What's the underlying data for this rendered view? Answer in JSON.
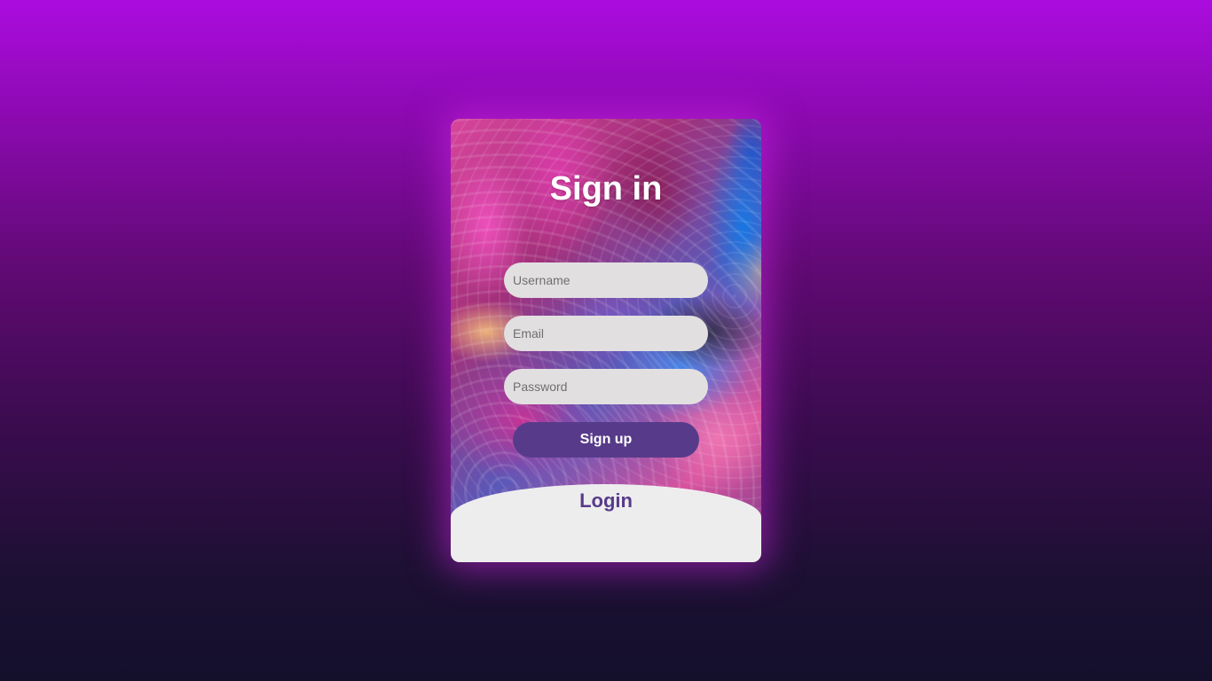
{
  "form": {
    "title": "Sign in",
    "username": {
      "placeholder": "Username",
      "value": ""
    },
    "email": {
      "placeholder": "Email",
      "value": ""
    },
    "password": {
      "placeholder": "Password",
      "value": ""
    },
    "submit_label": "Sign up"
  },
  "login": {
    "label": "Login"
  },
  "colors": {
    "accent": "#573b8a",
    "input_bg": "#e2dfe1",
    "panel_bg": "#eeedee"
  }
}
